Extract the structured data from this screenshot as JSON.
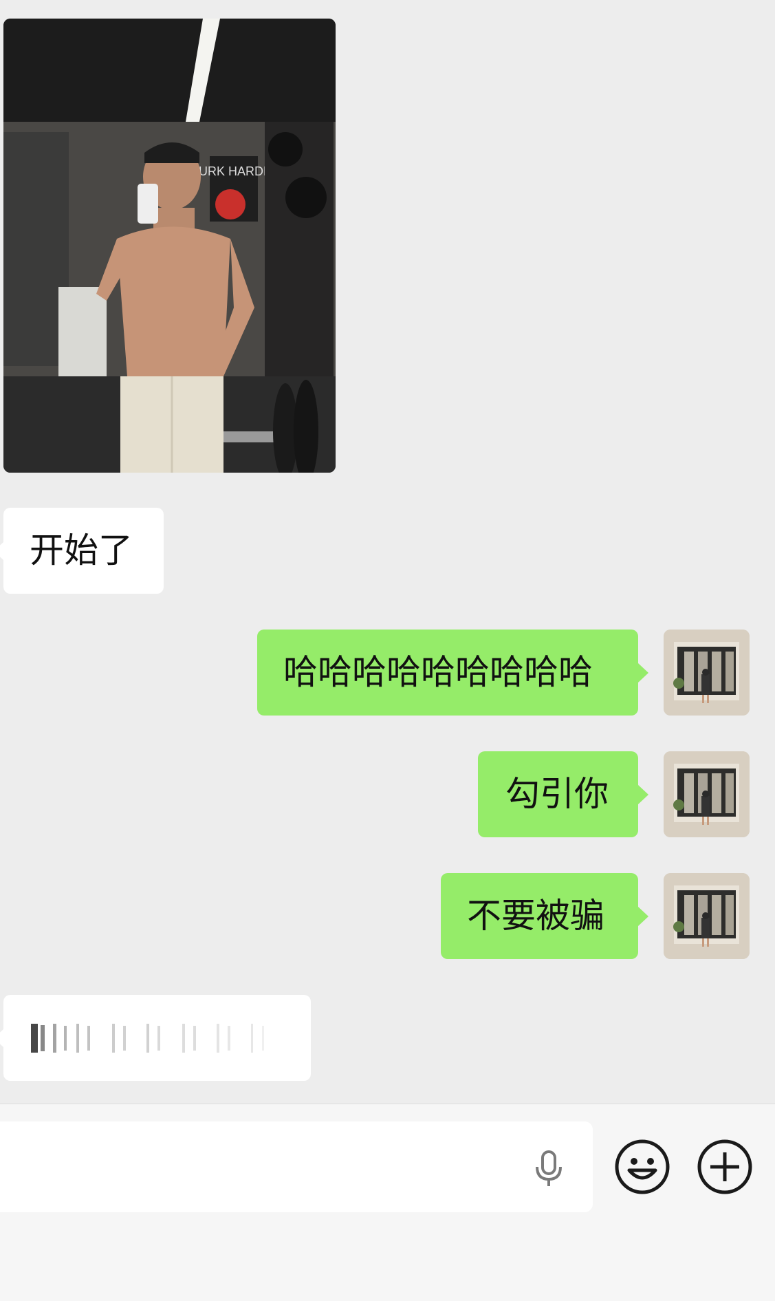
{
  "messages": [
    {
      "type": "image",
      "side": "left",
      "description": "gym selfie photo"
    },
    {
      "type": "text",
      "side": "left",
      "text": "开始了"
    },
    {
      "type": "text",
      "side": "right",
      "text": "哈哈哈哈哈哈哈哈哈"
    },
    {
      "type": "text",
      "side": "right",
      "text": "勾引你"
    },
    {
      "type": "text",
      "side": "right",
      "text": "不要被骗"
    },
    {
      "type": "voice",
      "side": "left"
    }
  ],
  "poster_text": "WURK HARDER",
  "input_bar": {
    "value": "",
    "icons": [
      "microphone-icon",
      "emoji-icon",
      "plus-icon"
    ]
  },
  "colors": {
    "background": "#ededed",
    "incoming_bubble": "#ffffff",
    "outgoing_bubble": "#95ec69",
    "input_bar": "#f6f6f6"
  }
}
